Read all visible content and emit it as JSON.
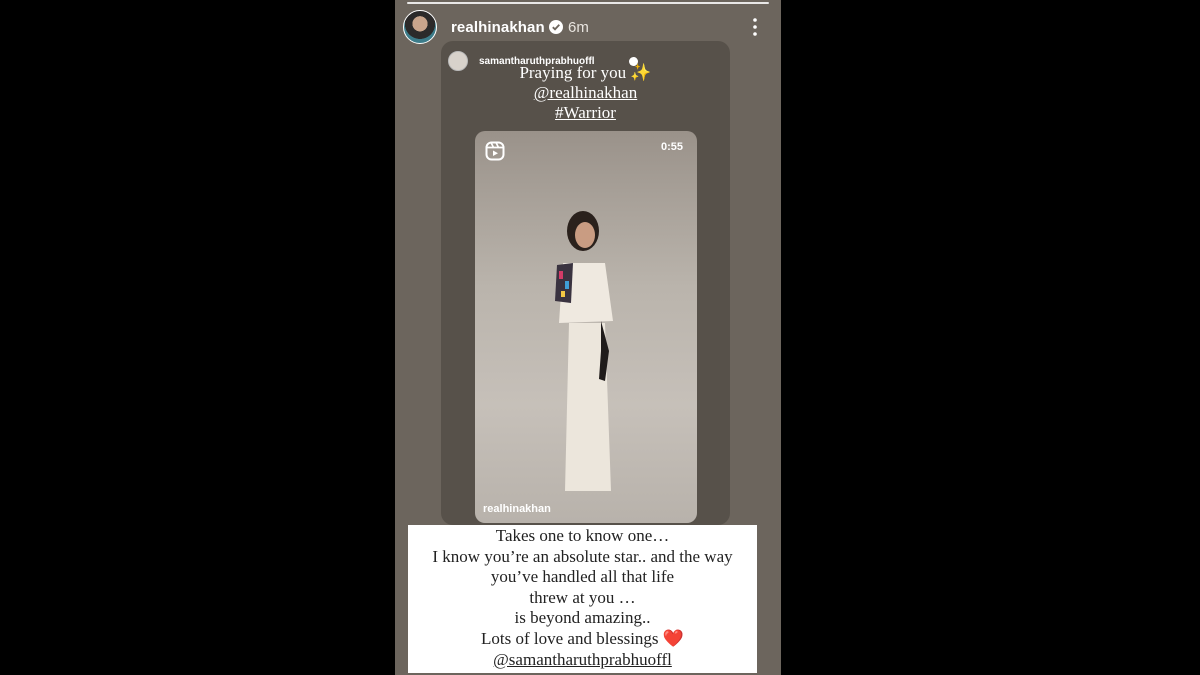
{
  "story": {
    "username": "realhinakhan",
    "time": "6m",
    "icons": {
      "verified": "verified-badge-icon",
      "more": "more-options-icon"
    }
  },
  "shared_post": {
    "username": "samantharuthprabhuoffl",
    "caption_lines": [
      "Praying for you ✨",
      "@realhinakhan",
      "#Warrior"
    ],
    "reel": {
      "duration": "0:55",
      "username": "realhinakhan",
      "icon": "reels-icon"
    }
  },
  "message": {
    "lines": [
      "Takes one to know one…",
      "I know you’re an absolute star.. and the way",
      "you’ve handled all that life",
      "threw at you …",
      "is beyond amazing..",
      "Lots of love and blessings ❤️",
      "@samantharuthprabhuoffl"
    ]
  },
  "colors": {
    "story_bg": "#6c655d",
    "card_bg": "#57514a",
    "verified": "#3897f0",
    "heart": "#e0245e"
  }
}
